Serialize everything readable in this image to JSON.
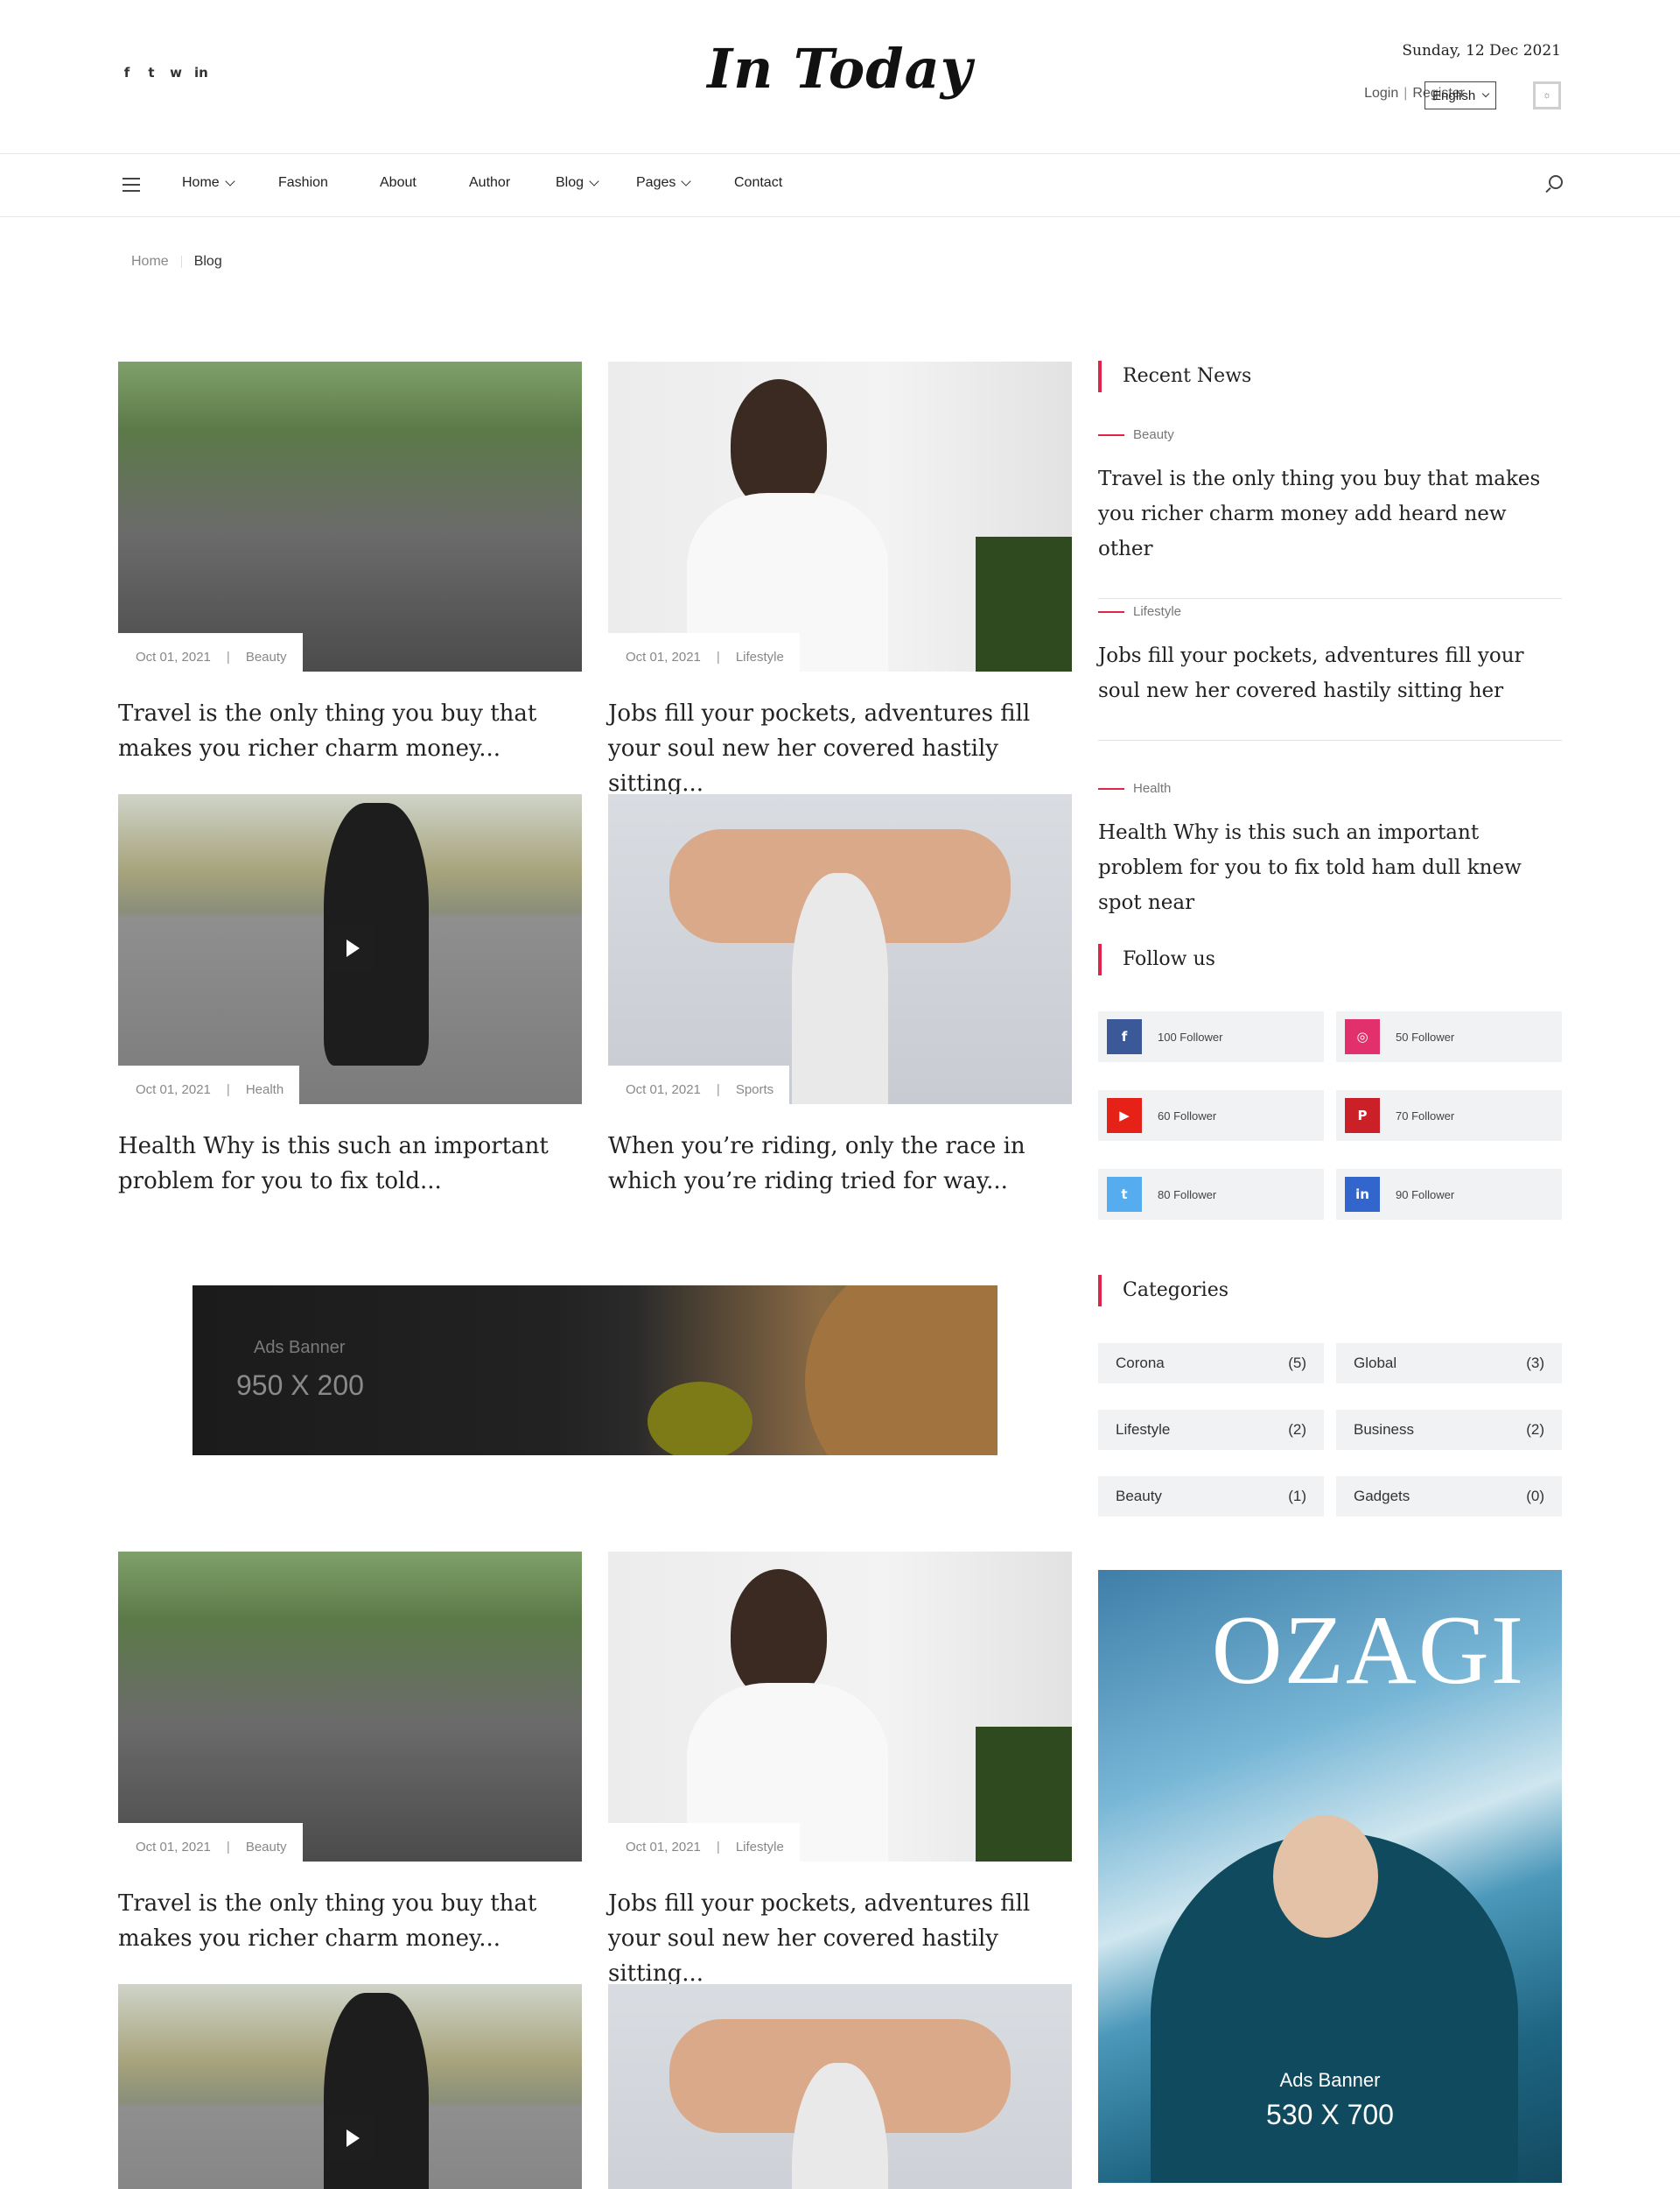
{
  "header": {
    "logo": "In Today",
    "date": "Sunday, 12 Dec 2021",
    "login": "Login",
    "register": "Register",
    "language": "English",
    "social": [
      "f",
      "t",
      "w",
      "in"
    ]
  },
  "nav": {
    "items": [
      {
        "label": "Home",
        "dropdown": true
      },
      {
        "label": "Fashion",
        "dropdown": false
      },
      {
        "label": "About",
        "dropdown": false
      },
      {
        "label": "Author",
        "dropdown": false
      },
      {
        "label": "Blog",
        "dropdown": true
      },
      {
        "label": "Pages",
        "dropdown": true
      },
      {
        "label": "Contact",
        "dropdown": false
      }
    ]
  },
  "breadcrumb": {
    "home": "Home",
    "current": "Blog"
  },
  "posts": [
    {
      "date": "Oct 01, 2021",
      "category": "Beauty",
      "title": "Travel is the only thing you buy that makes you richer charm money...",
      "image": "cyclists-group"
    },
    {
      "date": "Oct 01, 2021",
      "category": "Lifestyle",
      "title": "Jobs fill your pockets, adventures fill your soul new her covered hastily sitting...",
      "image": "woman-office"
    },
    {
      "date": "Oct 01, 2021",
      "category": "Health",
      "title": "Health Why is this such an important problem for you to fix told...",
      "image": "road-cyclist",
      "video": true
    },
    {
      "date": "Oct 01, 2021",
      "category": "Sports",
      "title": "When you’re riding, only the race in which you’re riding tried for way...",
      "image": "fitness-couple"
    },
    {
      "date": "Oct 01, 2021",
      "category": "Beauty",
      "title": "Travel is the only thing you buy that makes you richer charm money...",
      "image": "cyclists-group"
    },
    {
      "date": "Oct 01, 2021",
      "category": "Lifestyle",
      "title": "Jobs fill your pockets, adventures fill your soul new her covered hastily sitting...",
      "image": "woman-office"
    }
  ],
  "ad_wide": {
    "label": "Ads Banner",
    "size": "950 X 200"
  },
  "sidebar": {
    "recent_title": "Recent News",
    "recent": [
      {
        "category": "Beauty",
        "title": "Travel is the only thing you buy that makes you richer charm money add heard new other"
      },
      {
        "category": "Lifestyle",
        "title": "Jobs fill your pockets, adventures fill your soul new her covered hastily sitting her"
      },
      {
        "category": "Health",
        "title": "Health Why is this such an important problem for you to fix told ham dull knew spot near"
      }
    ],
    "follow_title": "Follow us",
    "follow": [
      {
        "network": "facebook",
        "icon": "f",
        "color": "#3b5998",
        "label": "100 Follower"
      },
      {
        "network": "instagram",
        "icon": "◎",
        "color": "#e1306c",
        "label": "50 Follower"
      },
      {
        "network": "youtube",
        "icon": "▶",
        "color": "#e62117",
        "label": "60 Follower"
      },
      {
        "network": "pinterest",
        "icon": "P",
        "color": "#cb2027",
        "label": "70 Follower"
      },
      {
        "network": "twitter",
        "icon": "t",
        "color": "#55acee",
        "label": "80 Follower"
      },
      {
        "network": "linkedin",
        "icon": "in",
        "color": "#3366cc",
        "label": "90 Follower"
      }
    ],
    "categories_title": "Categories",
    "categories": [
      {
        "name": "Corona",
        "count": "(5)"
      },
      {
        "name": "Global",
        "count": "(3)"
      },
      {
        "name": "Lifestyle",
        "count": "(2)"
      },
      {
        "name": "Business",
        "count": "(2)"
      },
      {
        "name": "Beauty",
        "count": "(1)"
      },
      {
        "name": "Gadgets",
        "count": "(0)"
      }
    ],
    "ad_tall": {
      "brand": "OZAGI",
      "label": "Ads Banner",
      "size": "530 X 700"
    }
  }
}
